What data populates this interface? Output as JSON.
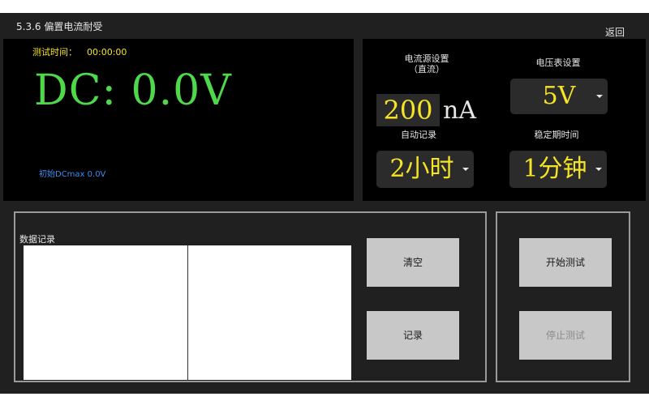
{
  "header": {
    "title": "5.3.6 偏置电流耐受",
    "back_label": "返回"
  },
  "reading_panel": {
    "test_time_label": "测试时间：",
    "test_time_value": "00:00:00",
    "dc_reading": "DC: 0.0V",
    "initial_dcmax": "初始DCmax 0.0V"
  },
  "settings_panel": {
    "current_source_label_line1": "电流源设置",
    "current_source_label_line2": "（直流）",
    "current_value": "200",
    "current_unit": "nA",
    "voltmeter_label": "电压表设置",
    "voltmeter_value": "5V",
    "auto_record_label": "自动记录",
    "auto_record_value": "2小时",
    "stabilization_label": "稳定期时间",
    "stabilization_value": "1分钟"
  },
  "log_section": {
    "label": "数据记录",
    "clear_label": "清空",
    "record_label": "记录"
  },
  "control_section": {
    "start_label": "开始测试",
    "stop_label": "停止测试"
  },
  "colors": {
    "reading_green": "#4fd84a",
    "highlight_yellow": "#f5e326",
    "info_blue": "#3c8cf0"
  }
}
